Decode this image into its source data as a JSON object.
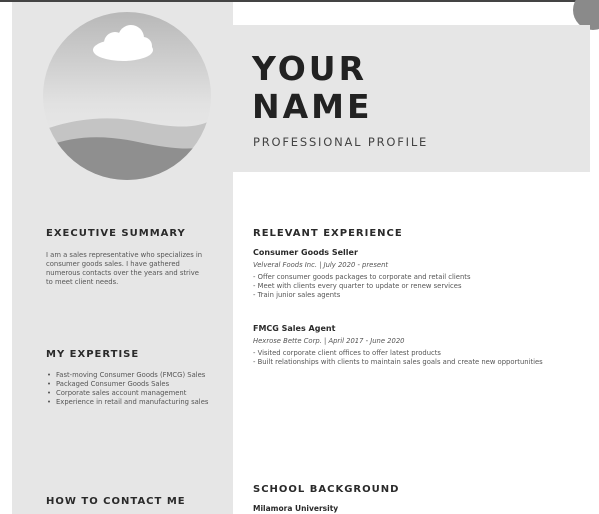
{
  "header": {
    "name_line1": "YOUR",
    "name_line2": "NAME",
    "subtitle": "PROFESSIONAL PROFILE"
  },
  "sidebar": {
    "summary_heading": "EXECUTIVE SUMMARY",
    "summary_text": "I am a sales representative who specializes in consumer goods sales. I have gathered numerous contacts over the years and strive to meet client needs.",
    "expertise_heading": "MY EXPERTISE",
    "expertise_items": [
      "Fast-moving Consumer Goods (FMCG) Sales",
      "Packaged Consumer Goods Sales",
      "Corporate sales account management",
      "Experience in retail and manufacturing sales"
    ],
    "contact_heading": "HOW TO CONTACT ME"
  },
  "experience": {
    "heading": "RELEVANT EXPERIENCE",
    "jobs": [
      {
        "title": "Consumer Goods Seller",
        "meta": "Velveral Foods Inc. | July 2020 - present",
        "lines": [
          "- Offer consumer goods packages to corporate and retail clients",
          "- Meet with clients every quarter to update or renew services",
          "- Train junior sales agents"
        ]
      },
      {
        "title": "FMCG Sales Agent",
        "meta": "Hexrose Bette Corp. | April 2017 - June 2020",
        "lines": [
          "- Visited corporate client offices to offer latest products",
          "- Built relationships with clients to maintain sales goals and create new opportunities"
        ]
      }
    ]
  },
  "education": {
    "heading": "SCHOOL BACKGROUND",
    "school": "Milamora University"
  },
  "photo": {
    "icon": "landscape-photo-placeholder",
    "sky_color": "#d2d2d2",
    "hill_color": "#8f8f8f"
  }
}
